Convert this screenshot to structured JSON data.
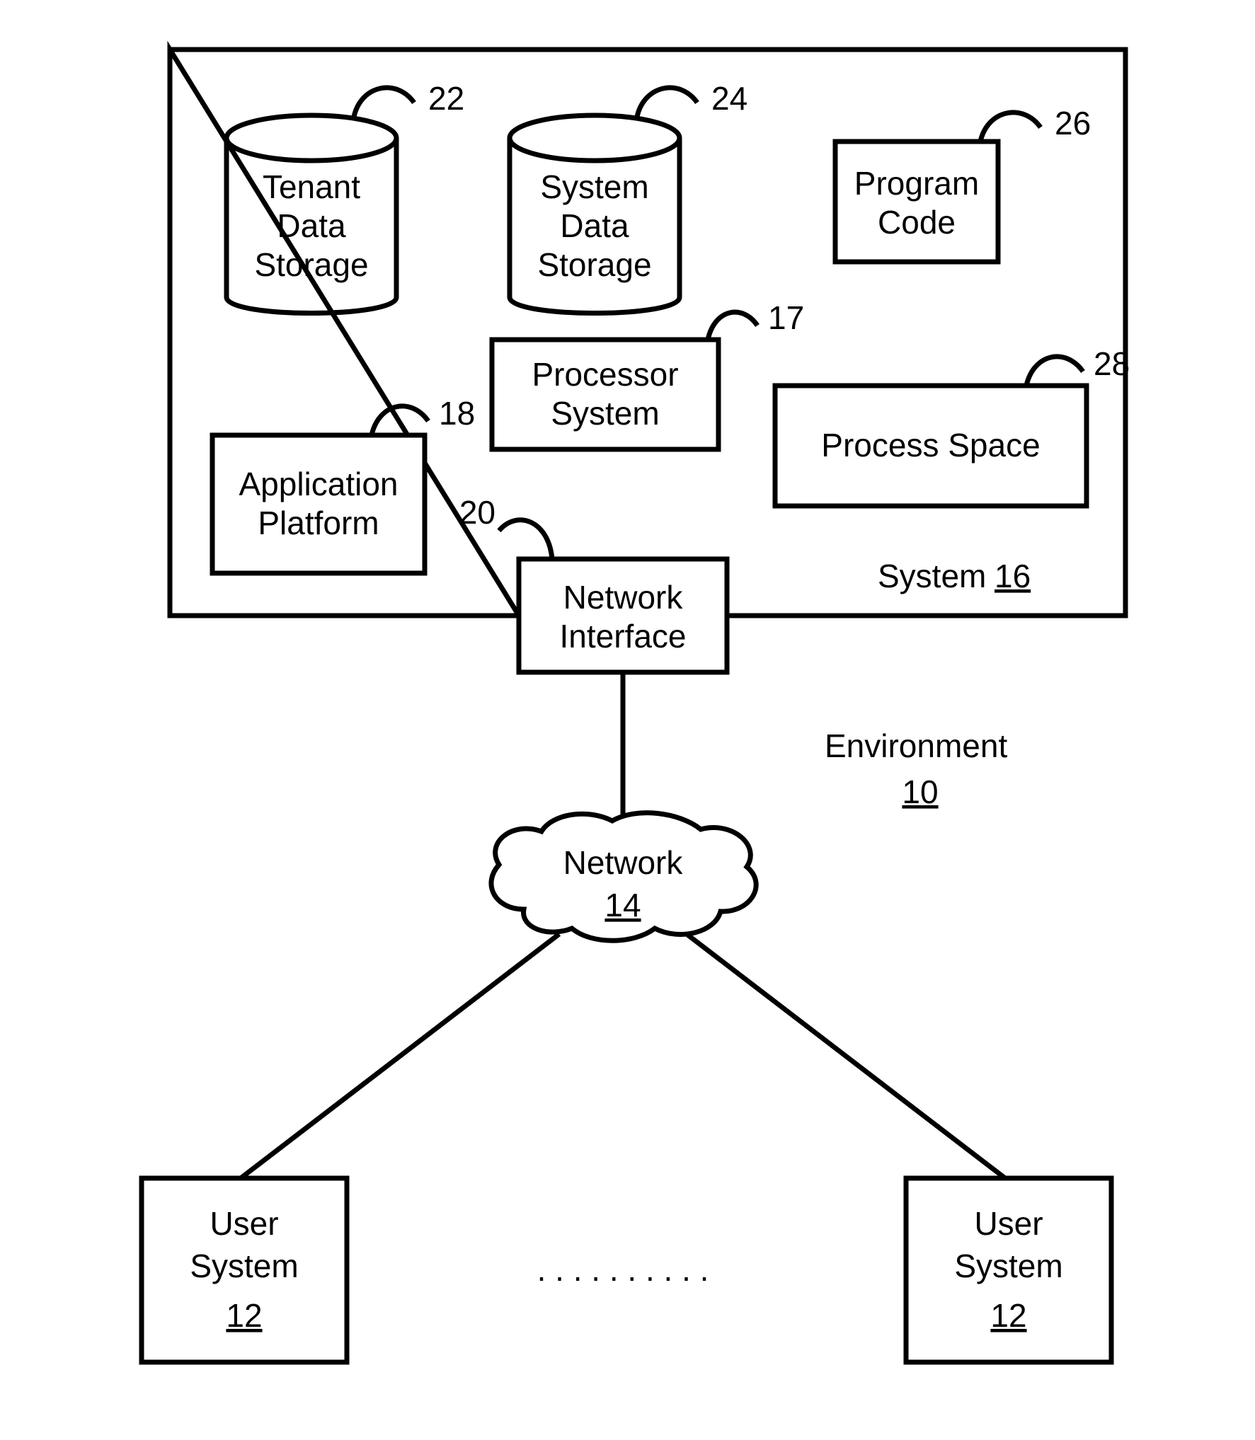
{
  "environment": {
    "label": "Environment",
    "ref": "10"
  },
  "system": {
    "label": "System",
    "ref": "16"
  },
  "tenant_data_storage": {
    "line1": "Tenant",
    "line2": "Data",
    "line3": "Storage",
    "ref": "22"
  },
  "system_data_storage": {
    "line1": "System",
    "line2": "Data",
    "line3": "Storage",
    "ref": "24"
  },
  "program_code": {
    "line1": "Program",
    "line2": "Code",
    "ref": "26"
  },
  "application_platform": {
    "line1": "Application",
    "line2": "Platform",
    "ref": "18"
  },
  "processor_system": {
    "line1": "Processor",
    "line2": "System",
    "ref": "17"
  },
  "process_space": {
    "label": "Process Space",
    "ref": "28"
  },
  "network_interface": {
    "line1": "Network",
    "line2": "Interface",
    "ref": "20"
  },
  "network": {
    "label": "Network",
    "ref": "14"
  },
  "user_system_left": {
    "line1": "User",
    "line2": "System",
    "ref": "12"
  },
  "user_system_right": {
    "line1": "User",
    "line2": "System",
    "ref": "12"
  },
  "ellipsis": ". . . . . . . . . ."
}
